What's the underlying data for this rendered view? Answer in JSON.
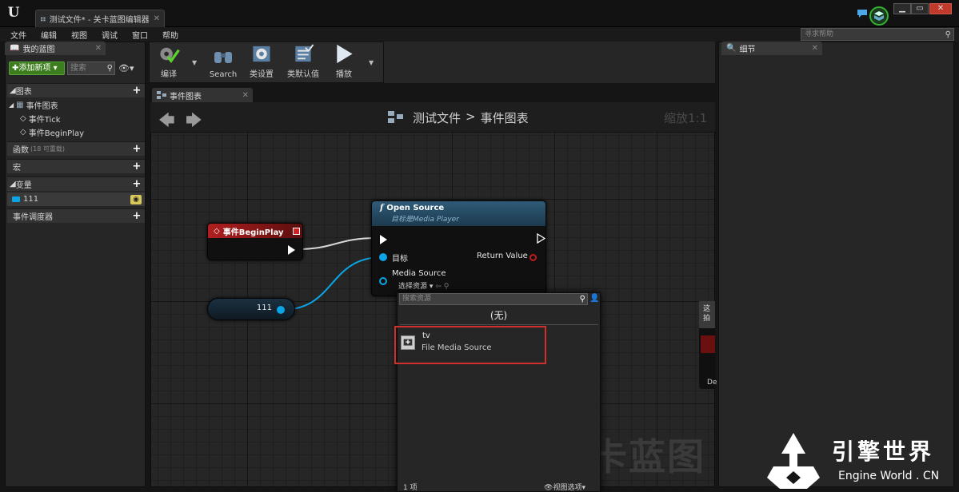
{
  "window": {
    "doc_tab_title": "测试文件* - 关卡蓝图编辑器",
    "min_btn": "▁",
    "max_btn": "▭",
    "close_btn": "✕"
  },
  "menu": [
    "文件",
    "编辑",
    "视图",
    "调试",
    "窗口",
    "帮助"
  ],
  "help_search": {
    "placeholder": "寻求帮助"
  },
  "my_blueprint": {
    "tab_label": "我的蓝图",
    "add_new_label": "添加新项",
    "search_placeholder": "搜索",
    "sections": {
      "graphs": "图表",
      "event_graph": "事件图表",
      "event_tick": "事件Tick",
      "event_beginplay": "事件BeginPlay",
      "functions": "函数",
      "functions_note": "(18 可重载)",
      "macros": "宏",
      "variables": "变量",
      "var_name": "111",
      "event_dispatchers": "事件调度器"
    }
  },
  "toolbar": {
    "compile": "编译",
    "search": "Search",
    "class_settings": "类设置",
    "class_defaults": "类默认值",
    "play": "播放"
  },
  "graph": {
    "tab_label": "事件图表",
    "breadcrumb_root": "测试文件",
    "breadcrumb_sep": ">",
    "breadcrumb_leaf": "事件图表",
    "zoom": "缩放1:1",
    "watermark": "关卡蓝图"
  },
  "nodes": {
    "begin_play": "事件BeginPlay",
    "var_get": "111",
    "open_source": {
      "title": "Open Source",
      "subtitle": "目标是Media Player",
      "target_label": "目标",
      "return_label": "Return Value",
      "media_source_label": "Media Source",
      "select_asset": "选择资源"
    }
  },
  "asset_picker": {
    "search_placeholder": "搜索资源",
    "none_label": "(无)",
    "items": [
      {
        "name": "tv",
        "type": "File Media Source"
      }
    ],
    "count": "1 项",
    "view_options": "视图选项"
  },
  "details": {
    "tab_label": "细节"
  },
  "partial_node": {
    "tip_line1": "这",
    "tip_line2": "拍",
    "text": "De"
  },
  "branding": {
    "cn": "引擎世界",
    "en": "Engine World . CN"
  },
  "colors": {
    "accent_green": "#3c7d1e",
    "begin_play_header": "#b11f1f",
    "function_header": "#2f5b78",
    "object_pin": "#0aa5e6",
    "highlight_border": "#d32f2f"
  }
}
